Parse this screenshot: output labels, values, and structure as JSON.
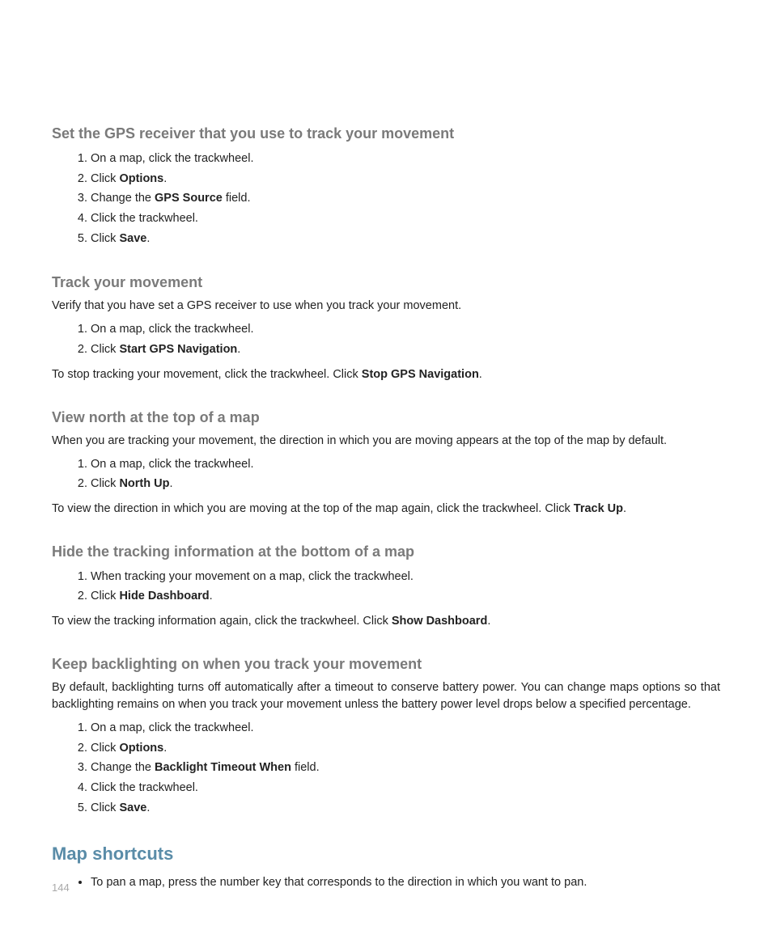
{
  "page_number": "144",
  "sections": {
    "s1": {
      "heading": "Set the GPS receiver that you use to track your movement",
      "steps": [
        "On a map, click the trackwheel.",
        "Click ",
        "Options",
        ".",
        "Change the ",
        "GPS Source",
        " field.",
        "Click the trackwheel.",
        "Click ",
        "Save",
        "."
      ]
    },
    "s2": {
      "heading": "Track your movement",
      "intro": "Verify that you have set a GPS receiver to use when you track your movement.",
      "step1": "On a map, click the trackwheel.",
      "step2_pre": "Click ",
      "step2_bold": "Start GPS Navigation",
      "step2_post": ".",
      "outro_pre": "To stop tracking your movement, click the trackwheel. Click ",
      "outro_bold": "Stop GPS Navigation",
      "outro_post": "."
    },
    "s3": {
      "heading": "View north at the top of a map",
      "intro": "When you are tracking your movement, the direction in which you are moving appears at the top of the map by default.",
      "step1": "On a map, click the trackwheel.",
      "step2_pre": "Click ",
      "step2_bold": "North Up",
      "step2_post": ".",
      "outro_pre": "To view the direction in which you are moving at the top of the map again, click the trackwheel. Click ",
      "outro_bold": "Track Up",
      "outro_post": "."
    },
    "s4": {
      "heading": "Hide the tracking information at the bottom of a map",
      "step1": "When tracking your movement on a map, click the trackwheel.",
      "step2_pre": "Click ",
      "step2_bold": "Hide Dashboard",
      "step2_post": ".",
      "outro_pre": "To view the tracking information again, click the trackwheel. Click ",
      "outro_bold": "Show Dashboard",
      "outro_post": "."
    },
    "s5": {
      "heading": "Keep backlighting on when you track your movement",
      "intro": "By default, backlighting turns off automatically after a timeout to conserve battery power. You can change maps options so that backlighting remains on when you track your movement unless the battery power level drops below a specified percentage.",
      "step1": "On a map, click the trackwheel.",
      "step2_pre": "Click ",
      "step2_bold": "Options",
      "step2_post": ".",
      "step3_pre": "Change the ",
      "step3_bold": "Backlight Timeout When",
      "step3_post": " field.",
      "step4": "Click the trackwheel.",
      "step5_pre": "Click ",
      "step5_bold": "Save",
      "step5_post": "."
    },
    "s6": {
      "heading": "Map shortcuts",
      "bullet1": "To pan a map, press the number key that corresponds to the direction in which you want to pan."
    }
  }
}
